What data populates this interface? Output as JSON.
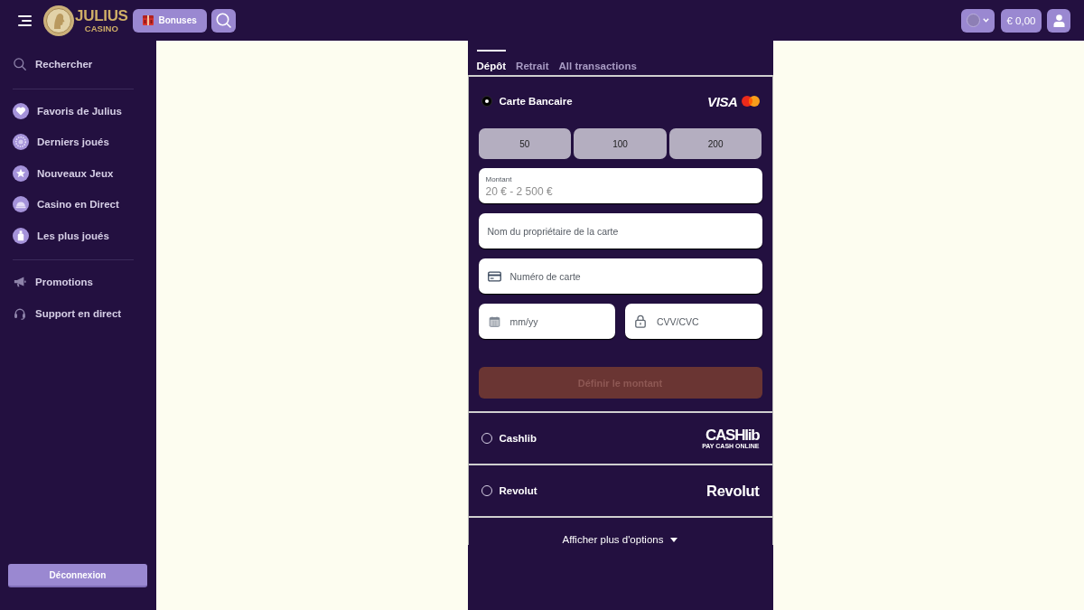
{
  "top_bar": {
    "logo": {
      "title": "JULIUS",
      "subtitle": "CASINO"
    },
    "bonuses_button": {
      "label": "Bonuses"
    },
    "balance_button": {
      "label": "€ 0,00"
    }
  },
  "sidebar": {
    "groups": [
      {
        "items": [
          {
            "label": "Rechercher"
          }
        ]
      },
      {
        "items": [
          {
            "label": "Favoris de Julius"
          },
          {
            "label": "Derniers joués"
          },
          {
            "label": "Nouveaux Jeux"
          },
          {
            "label": "Casino en Direct"
          },
          {
            "label": "Les plus joués"
          }
        ]
      },
      {
        "items": [
          {
            "label": "Promotions"
          },
          {
            "label": "Support en direct"
          }
        ]
      }
    ],
    "logout_button": {
      "label": "Déconnexion"
    }
  },
  "cashier": {
    "tabs": [
      {
        "label": "Dépôt",
        "selected": true
      },
      {
        "label": "Retrait",
        "selected": false
      },
      {
        "label": "All transactions",
        "selected": false
      }
    ],
    "payment_methods": [
      {
        "kind": "card",
        "name": "Carte Bancaire",
        "selected": true,
        "logo": {
          "kind": "visa",
          "text": "VISA"
        },
        "quick_amounts": [
          "50",
          "100",
          "200"
        ],
        "amount_field": {
          "label": "Montant",
          "placeholder": "20 € - 2 500 €"
        },
        "field_rows": [
          [
            {
              "kind": "plain",
              "placeholder": "Nom du propriétaire de la carte"
            }
          ],
          [
            {
              "kind": "card",
              "placeholder": "Numéro de carte"
            }
          ],
          [
            {
              "kind": "calendar",
              "placeholder": "mm/yy"
            },
            {
              "kind": "lock",
              "placeholder": "CVV/CVC"
            }
          ]
        ],
        "submit_button": {
          "label": "Définir le montant",
          "disabled": true
        }
      },
      {
        "kind": "wallet",
        "name": "Cashlib",
        "selected": false,
        "logo": {
          "kind": "cashlib",
          "text": "CASHlib",
          "tagline": "PAY CASH ONLINE"
        }
      },
      {
        "kind": "wallet",
        "name": "Revolut",
        "selected": false,
        "logo": {
          "kind": "revolut",
          "text": "Revolut"
        }
      }
    ],
    "more_options": {
      "label": "Afficher plus d'options"
    }
  }
}
